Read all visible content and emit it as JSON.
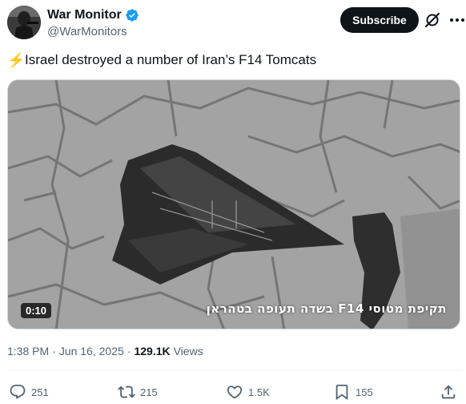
{
  "author": {
    "name": "War Monitor",
    "handle": "@WarMonitors",
    "avatar_icon": "soldier-avatar",
    "verified": true,
    "verified_color": "#1d9bf0"
  },
  "subscribe_label": "Subscribe",
  "tweet": {
    "emoji": "⚡",
    "text": "Israel destroyed a number of Iran’s F14 Tomcats"
  },
  "media": {
    "type": "video",
    "duration": "0:10",
    "overlay_caption": "תקיפת מטוסי F14 בשדה תעופה בטהראן"
  },
  "meta": {
    "time": "1:38 PM",
    "separator": "·",
    "date": "Jun 16, 2025",
    "views_count": "129.1K",
    "views_label": "Views"
  },
  "actions": {
    "replies": "251",
    "reposts": "215",
    "likes": "1.5K",
    "bookmarks": "155"
  },
  "colors": {
    "text_primary": "#0f1419",
    "text_secondary": "#536471",
    "accent": "#1d9bf0"
  }
}
